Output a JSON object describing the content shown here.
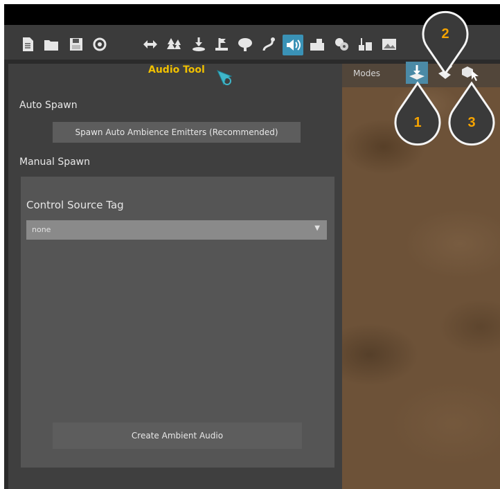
{
  "toolbar": {
    "file_icons": [
      "new-file-icon",
      "open-folder-icon",
      "save-icon",
      "refresh-icon"
    ],
    "tool_icons": [
      "move-icon",
      "trees-icon",
      "placement-icon",
      "decor-icon",
      "foliage-icon",
      "spline-icon",
      "audio-icon",
      "build-icon",
      "gear-group-icon",
      "weights-icon",
      "image-icon"
    ]
  },
  "panel": {
    "title": "Audio Tool",
    "auto_spawn_label": "Auto Spawn",
    "spawn_button": "Spawn Auto Ambience Emitters (Recommended)",
    "manual_spawn_label": "Manual Spawn",
    "control_source_tag_label": "Control Source Tag",
    "control_source_tag_value": "none",
    "create_button": "Create Ambient Audio"
  },
  "modes": {
    "label": "Modes",
    "buttons": [
      "place-mode-icon",
      "paint-mode-icon",
      "select-mode-icon"
    ]
  },
  "callouts": [
    "1",
    "2",
    "3"
  ],
  "colors": {
    "accent": "#3a92b6",
    "title": "#f0c000",
    "callout_number": "#f5a300",
    "panel_bg": "#3f3f3f"
  }
}
